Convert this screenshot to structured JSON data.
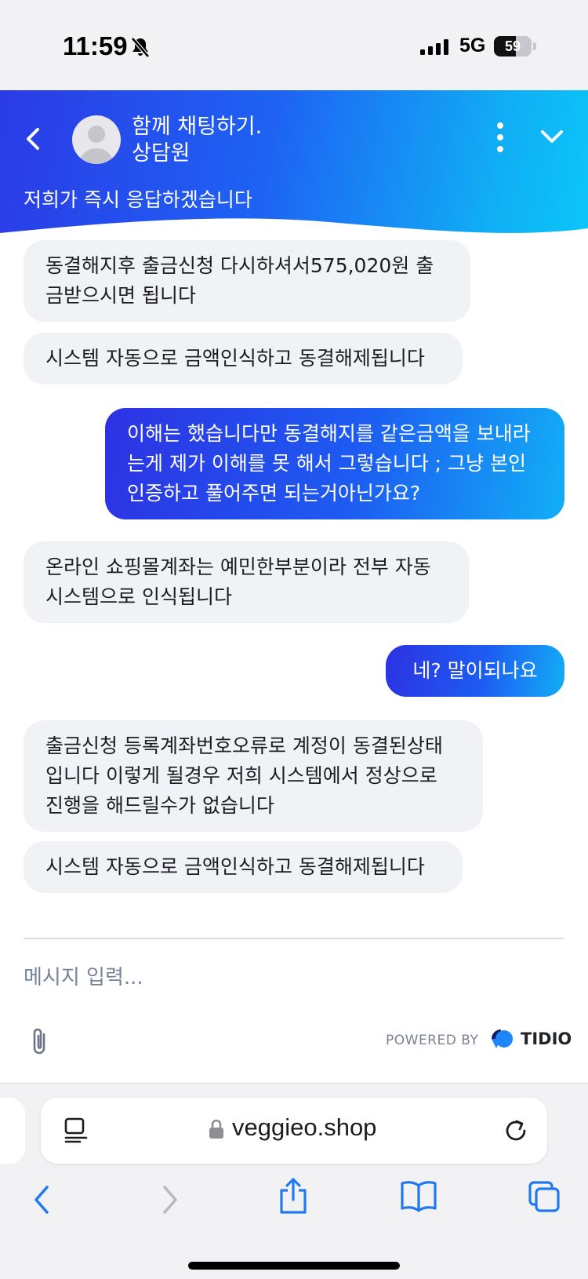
{
  "status": {
    "time": "11:59",
    "network": "5G",
    "battery": "59",
    "battery_level": 0.59
  },
  "header": {
    "title": "함께 채팅하기.",
    "role": "상담원",
    "subtitle": "저희가 즉시 응답하겠습니다"
  },
  "messages": [
    {
      "sender": "agent",
      "lines": [
        "동결해지후 출금신청 다시하셔서575,020원 출",
        "금받으시면 됩니다"
      ]
    },
    {
      "sender": "agent",
      "lines": [
        "시스템 자동으로 금액인식하고 동결해제됩니다"
      ]
    },
    {
      "sender": "user",
      "lines": [
        "이해는 했습니다만 동결해지를 같은금액을 보내라",
        "는게 제가 이해를 못 해서 그렇습니다 ; 그냥 본인",
        "인증하고 풀어주면 되는거아닌가요?"
      ]
    },
    {
      "sender": "agent",
      "lines": [
        "온라인 쇼핑몰계좌는 예민한부분이라 전부 자동",
        "시스템으로 인식됩니다"
      ]
    },
    {
      "sender": "user",
      "lines": [
        "네? 말이되나요"
      ]
    },
    {
      "sender": "agent",
      "lines": [
        "출금신청 등록계좌번호오류로 계정이 동결된상태",
        "입니다 이렇게 될경우 저희 시스템에서 정상으로",
        "진행을 해드릴수가 없습니다"
      ]
    },
    {
      "sender": "agent",
      "lines": [
        "시스템 자동으로 금액인식하고 동결해제됩니다"
      ]
    }
  ],
  "composer": {
    "placeholder": "메시지 입력...",
    "powered_by": "POWERED BY",
    "brand": "TIDIO"
  },
  "browser": {
    "url": "veggieo.shop"
  }
}
